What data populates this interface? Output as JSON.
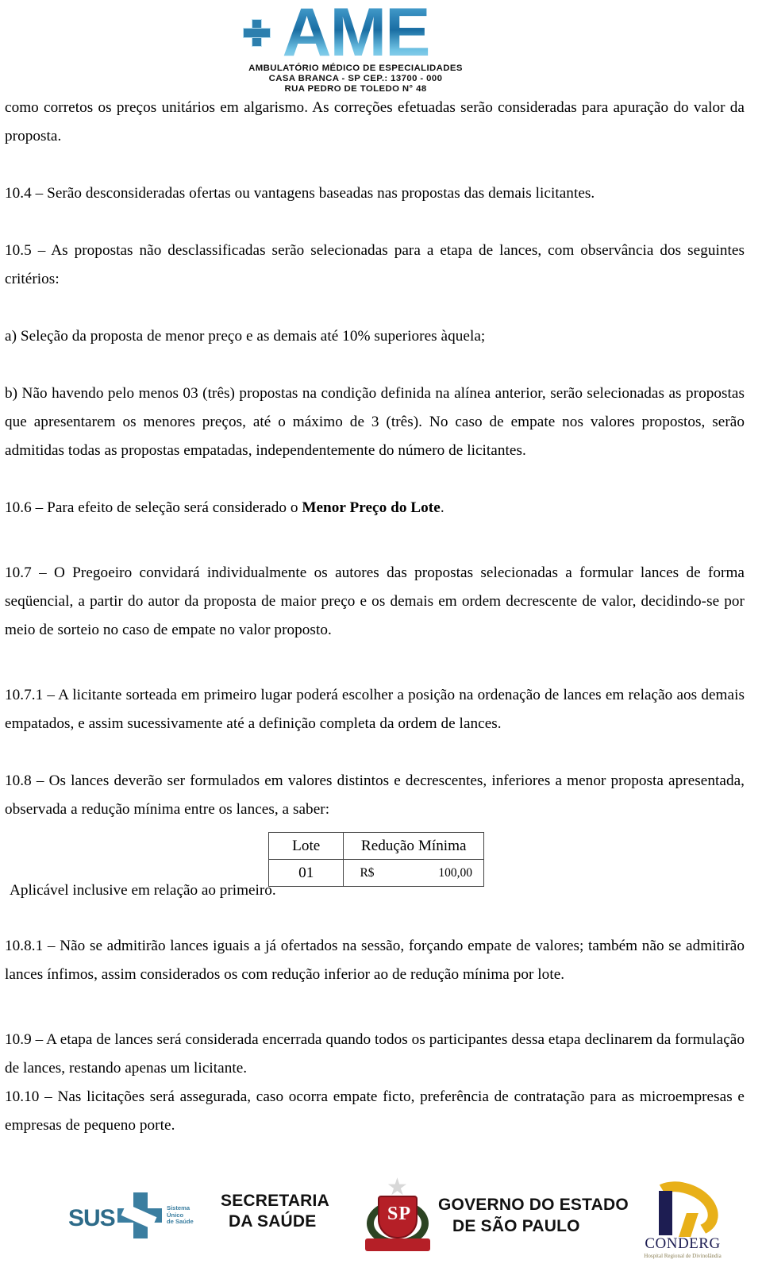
{
  "header": {
    "logo": {
      "word": "AME",
      "line1": "AMBULATÓRIO MÉDICO DE ESPECIALIDADES",
      "line2": "CASA BRANCA - SP  CEP.: 13700 - 000",
      "line3": "RUA PEDRO DE TOLEDO N° 48",
      "brand_color": "#2f85b8"
    }
  },
  "document": {
    "paragraphs": {
      "continuation": "como corretos os preços unitários em algarismo. As correções efetuadas serão consideradas para apuração do valor da proposta.",
      "p_10_4": "10.4 – Serão desconsideradas ofertas ou vantagens baseadas nas propostas das demais licitantes.",
      "p_10_5": "10.5 – As propostas não desclassificadas serão selecionadas para a etapa de lances, com observância dos seguintes critérios:",
      "p_a": "a) Seleção da proposta de menor preço e as demais até 10% superiores àquela;",
      "p_b": "b) Não havendo pelo menos 03 (três) propostas na condição definida na alínea anterior, serão selecionadas as propostas que apresentarem os menores preços, até o máximo de 3 (três). No caso de empate nos valores propostos, serão admitidas todas as propostas empatadas, independentemente do número de licitantes.",
      "p_10_6_prefix": "10.6 – Para efeito de seleção será considerado o ",
      "p_10_6_bold": "Menor Preço do Lote",
      "p_10_6_suffix": ".",
      "p_10_7": "10.7 – O Pregoeiro convidará individualmente os autores das propostas selecionadas a formular lances de forma seqüencial, a partir do autor da proposta de maior preço e os demais em ordem decrescente de valor, decidindo-se por meio de sorteio no caso de empate no valor proposto.",
      "p_10_7_1": "10.7.1 – A licitante sorteada em primeiro lugar poderá escolher a posição na ordenação de lances em relação aos demais empatados, e assim sucessivamente até a definição completa da ordem de lances.",
      "p_10_8": "10.8 – Os lances deverão ser formulados em valores distintos e decrescentes, inferiores a menor proposta apresentada, observada a redução mínima entre os lances, a saber:",
      "p_aplicavel": "Aplicável inclusive em relação ao primeiro.",
      "p_10_8_1": "10.8.1 – Não se admitirão lances iguais a já ofertados na sessão, forçando empate de valores; também não se admitirão lances ínfimos, assim considerados os com redução inferior ao de redução mínima por lote.",
      "p_10_9": "10.9 – A etapa de lances será considerada encerrada quando todos os participantes dessa etapa declinarem da formulação de lances, restando apenas um licitante.",
      "p_10_10": "10.10 – Nas licitações será assegurada, caso ocorra empate ficto, preferência de contratação para as microempresas e empresas de pequeno porte."
    },
    "table": {
      "headers": [
        "Lote",
        "Redução Mínima"
      ],
      "rows": [
        {
          "lote": "01",
          "currency": "R$",
          "amount": "100,00"
        }
      ]
    }
  },
  "footer": {
    "sus": {
      "name": "SUS",
      "tagline_line1": "Sistema",
      "tagline_line2": "Único",
      "tagline_line3": "de Saúde",
      "color": "#3b7ea0"
    },
    "secretaria": {
      "line1": "SECRETARIA",
      "line2": "DA SAÚDE"
    },
    "governo": {
      "emblem_text": "SP",
      "line1": "GOVERNO DO ESTADO",
      "line2": "DE SÃO PAULO",
      "color": "#b51f27"
    },
    "conderg": {
      "name": "CONDERG",
      "tagline": "Hospital Regional de Divinolândia",
      "mark_color": "#1d1d52",
      "accent_color": "#e8b019"
    }
  }
}
